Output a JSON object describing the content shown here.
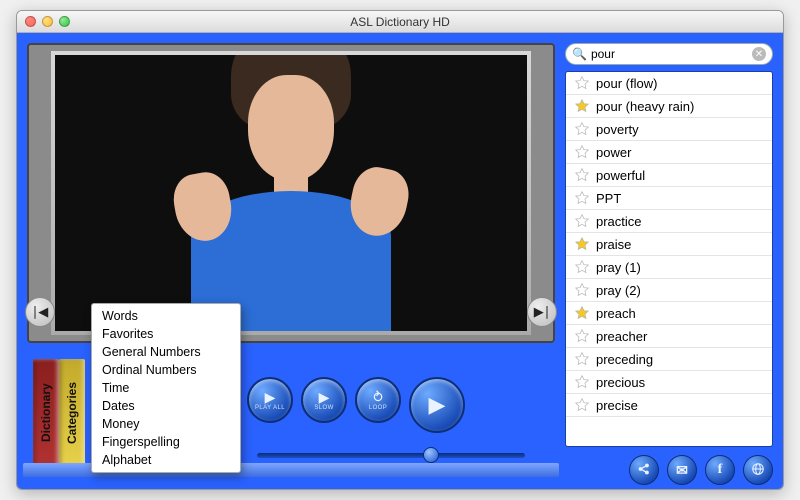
{
  "window": {
    "title": "ASL Dictionary HD"
  },
  "books": {
    "dictionary": "Dictionary",
    "categories": "Categories"
  },
  "popup": {
    "items": [
      "Words",
      "Favorites",
      "General Numbers",
      "Ordinal Numbers",
      "Time",
      "Dates",
      "Money",
      "Fingerspelling",
      "Alphabet"
    ]
  },
  "controls": {
    "playall": "PLAY ALL",
    "slow": "SLOW",
    "loop": "LOOP"
  },
  "slider": {
    "position_pct": 62
  },
  "search": {
    "value": "pour"
  },
  "wordlist": [
    {
      "label": "pour (flow)",
      "fav": false
    },
    {
      "label": "pour (heavy rain)",
      "fav": true
    },
    {
      "label": "poverty",
      "fav": false
    },
    {
      "label": "power",
      "fav": false
    },
    {
      "label": "powerful",
      "fav": false
    },
    {
      "label": "PPT",
      "fav": false
    },
    {
      "label": "practice",
      "fav": false
    },
    {
      "label": "praise",
      "fav": true
    },
    {
      "label": "pray (1)",
      "fav": false
    },
    {
      "label": "pray (2)",
      "fav": false
    },
    {
      "label": "preach",
      "fav": true
    },
    {
      "label": "preacher",
      "fav": false
    },
    {
      "label": "preceding",
      "fav": false
    },
    {
      "label": "precious",
      "fav": false
    },
    {
      "label": "precise",
      "fav": false
    }
  ]
}
